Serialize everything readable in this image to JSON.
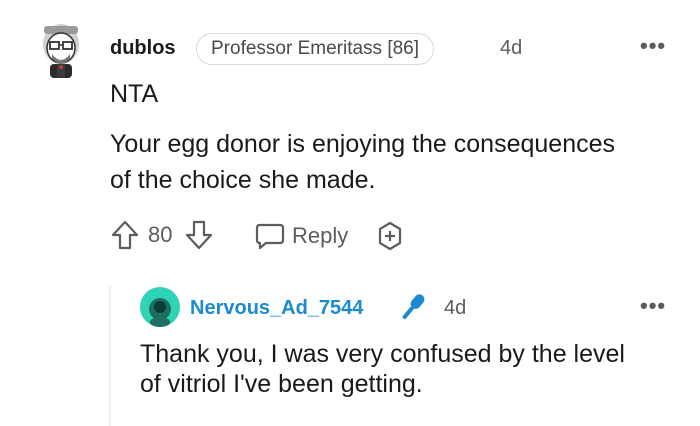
{
  "comment": {
    "username": "dublos",
    "flair": "Professor Emeritass [86]",
    "age": "4d",
    "more": "•••",
    "lines": [
      "NTA",
      "Your egg donor is enjoying the consequences",
      "of the choice she made."
    ],
    "votes": "80",
    "reply_label": "Reply"
  },
  "reply": {
    "username": "Nervous_Ad_7544",
    "age": "4d",
    "more": "•••",
    "lines": [
      "Thank you, I was very confused by the level",
      "of vitriol I've been getting."
    ]
  },
  "colors": {
    "reply_username": "#1a8ad1",
    "mic_icon": "#1a8ad1",
    "avatar2_bg": "#2ed4b5"
  }
}
